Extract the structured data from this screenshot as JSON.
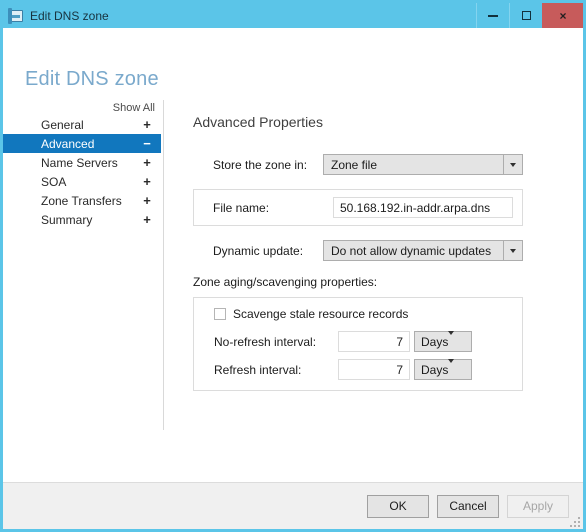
{
  "window": {
    "title": "Edit DNS zone",
    "icon": "dns-zone-icon",
    "controls": {
      "minimize": "minimize-icon",
      "maximize": "maximize-icon",
      "close": "close-icon",
      "close_glyph": "×"
    },
    "colors": {
      "titlebar": "#5bc5e8",
      "close_button": "#c75b5b",
      "accent_selected": "#1177be",
      "heading": "#7aa9cc"
    }
  },
  "page": {
    "title": "Edit DNS zone"
  },
  "sidebar": {
    "show_all": "Show All",
    "items": [
      {
        "label": "General",
        "sign": "+",
        "selected": false
      },
      {
        "label": "Advanced",
        "sign": "−",
        "selected": true
      },
      {
        "label": "Name Servers",
        "sign": "+",
        "selected": false
      },
      {
        "label": "SOA",
        "sign": "+",
        "selected": false
      },
      {
        "label": "Zone Transfers",
        "sign": "+",
        "selected": false
      },
      {
        "label": "Summary",
        "sign": "+",
        "selected": false
      }
    ]
  },
  "main": {
    "section_title": "Advanced Properties",
    "store_zone": {
      "label": "Store the zone in:",
      "value": "Zone file"
    },
    "file_name": {
      "label": "File name:",
      "value": "50.168.192.in-addr.arpa.dns"
    },
    "dynamic_update": {
      "label": "Dynamic update:",
      "value": "Do not allow dynamic updates"
    },
    "aging": {
      "section_label": "Zone aging/scavenging properties:",
      "scavenge_checkbox_label": "Scavenge stale resource records",
      "scavenge_checked": false,
      "no_refresh": {
        "label": "No-refresh interval:",
        "value": "7",
        "unit": "Days"
      },
      "refresh": {
        "label": "Refresh interval:",
        "value": "7",
        "unit": "Days"
      }
    }
  },
  "footer": {
    "ok": "OK",
    "cancel": "Cancel",
    "apply": "Apply",
    "apply_disabled": true
  }
}
